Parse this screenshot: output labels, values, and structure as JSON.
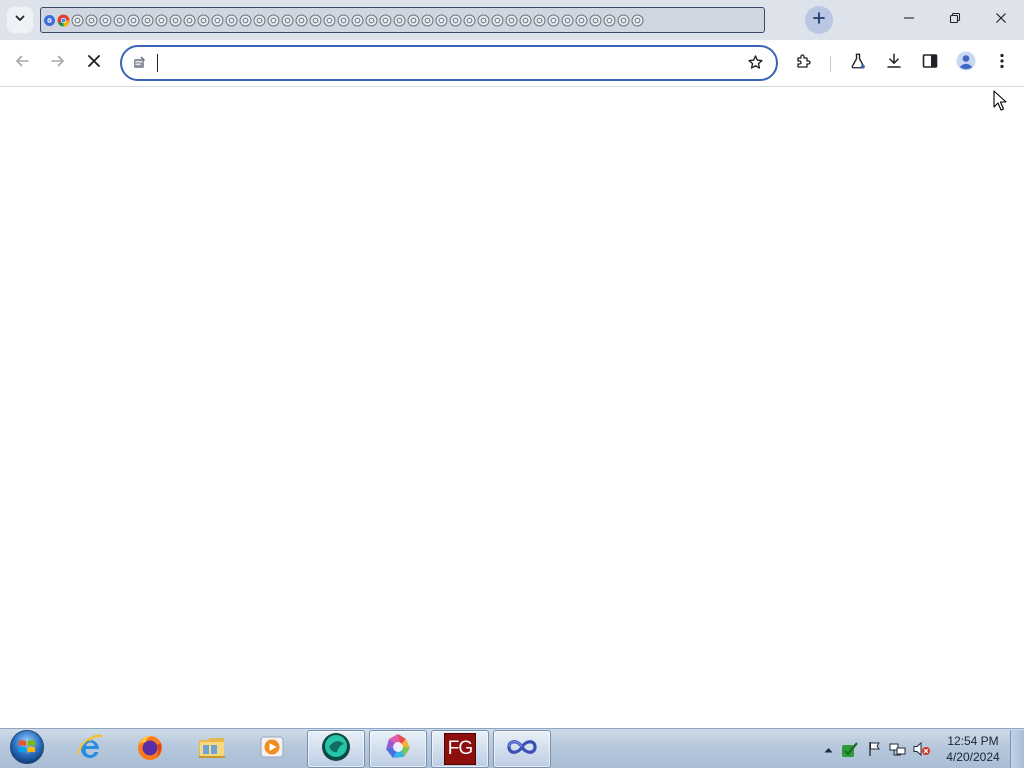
{
  "browser": {
    "tab_count_visible": 43,
    "omnibox": {
      "value": "",
      "placeholder": ""
    },
    "accent_color": "#3b63b8",
    "tabstrip_color": "#dee3eb"
  },
  "taskbar": {
    "apps": [
      {
        "name": "Internet Explorer",
        "icon": "internet-explorer-icon"
      },
      {
        "name": "Firefox",
        "icon": "firefox-icon"
      },
      {
        "name": "File Explorer",
        "icon": "folder-icon"
      },
      {
        "name": "Media Player",
        "icon": "media-player-icon"
      },
      {
        "name": "Chrome Canary",
        "icon": "app-round-green-icon"
      },
      {
        "name": "Photo app",
        "icon": "aperture-icon"
      },
      {
        "name": "FG",
        "icon": "fg-icon",
        "label": "FG"
      },
      {
        "name": "Infinity app",
        "icon": "infinity-icon"
      }
    ],
    "clock": {
      "time": "12:54 PM",
      "date": "4/20/2024"
    }
  }
}
